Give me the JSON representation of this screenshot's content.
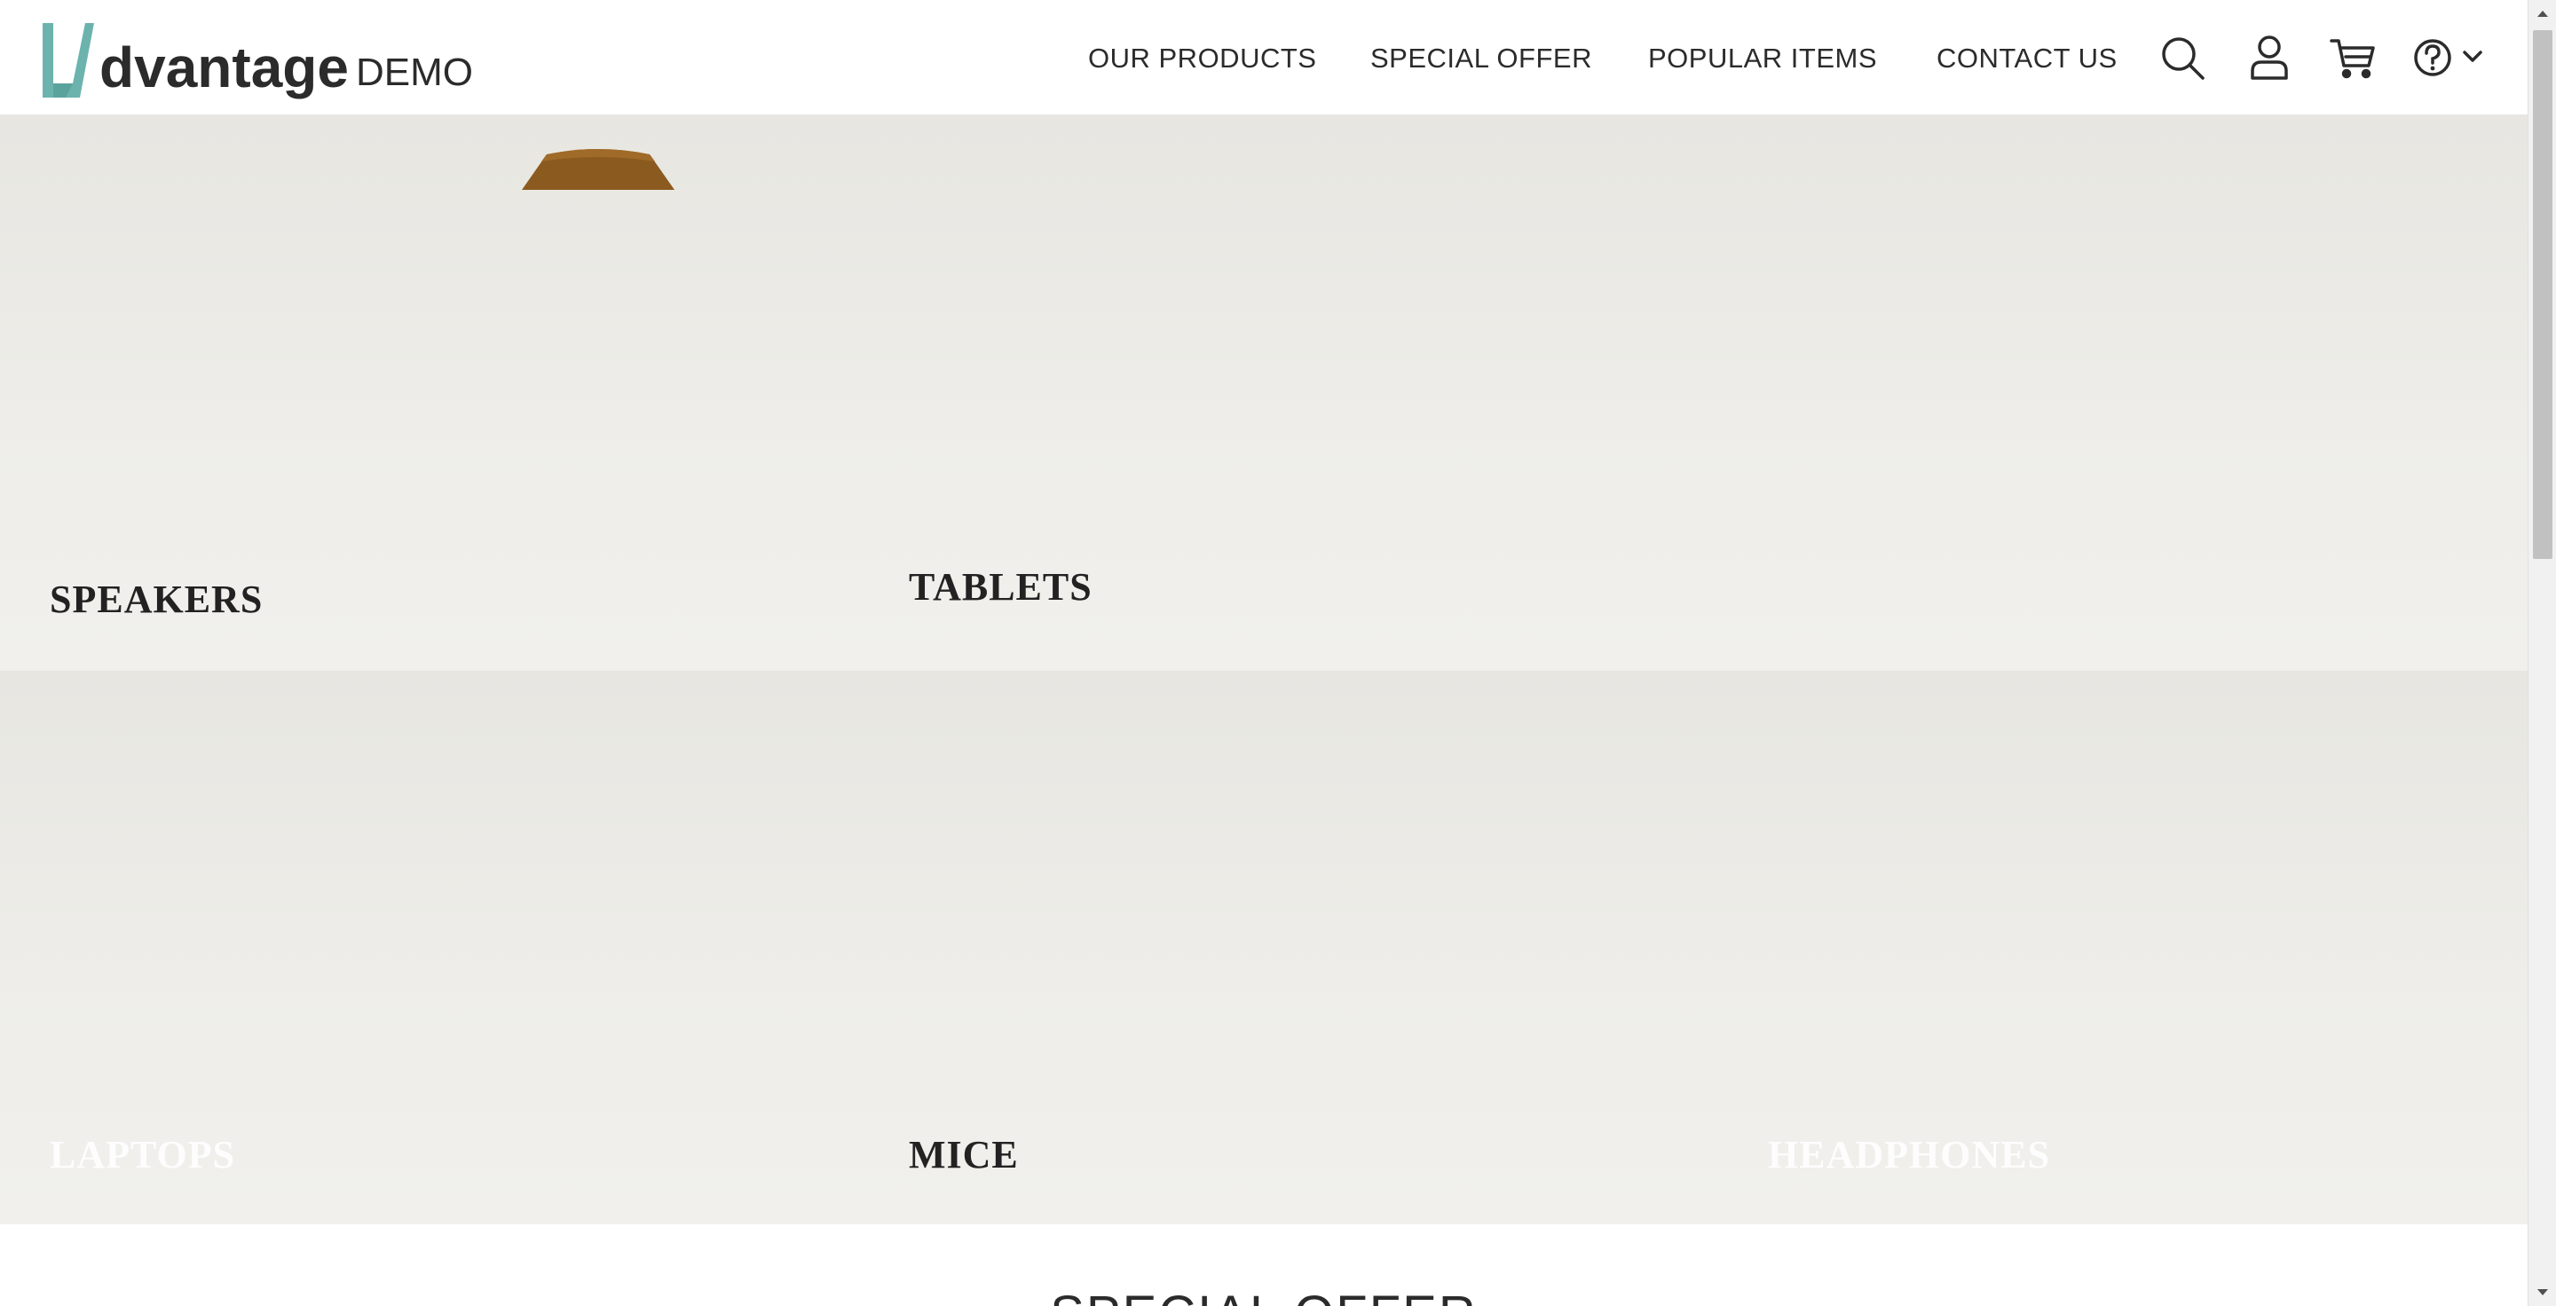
{
  "header": {
    "logo": {
      "word": "dvantage",
      "suffix": "DEMO",
      "mark_color": "#6cb3ad"
    },
    "nav": [
      {
        "label": "OUR PRODUCTS"
      },
      {
        "label": "SPECIAL OFFER"
      },
      {
        "label": "POPULAR ITEMS"
      },
      {
        "label": "CONTACT US"
      }
    ],
    "icons": [
      "search-icon",
      "user-icon",
      "cart-icon",
      "help-icon",
      "chevron-down-icon"
    ]
  },
  "categories": [
    {
      "label": "SPEAKERS",
      "label_color": "#222222"
    },
    {
      "label": "TABLETS",
      "label_color": "#222222"
    },
    {
      "label": "LAPTOPS",
      "label_color": "#ffffff"
    },
    {
      "label": "MICE",
      "label_color": "#222222"
    },
    {
      "label": "HEADPHONES",
      "label_color": "#ffffff"
    }
  ],
  "special_offer": {
    "title": "SPECIAL OFFER"
  },
  "colors": {
    "accent": "#6cb3ad",
    "text": "#2b2b2b",
    "tile_bg": "#ebeae6",
    "speaker_top": "#8b5a1f"
  }
}
